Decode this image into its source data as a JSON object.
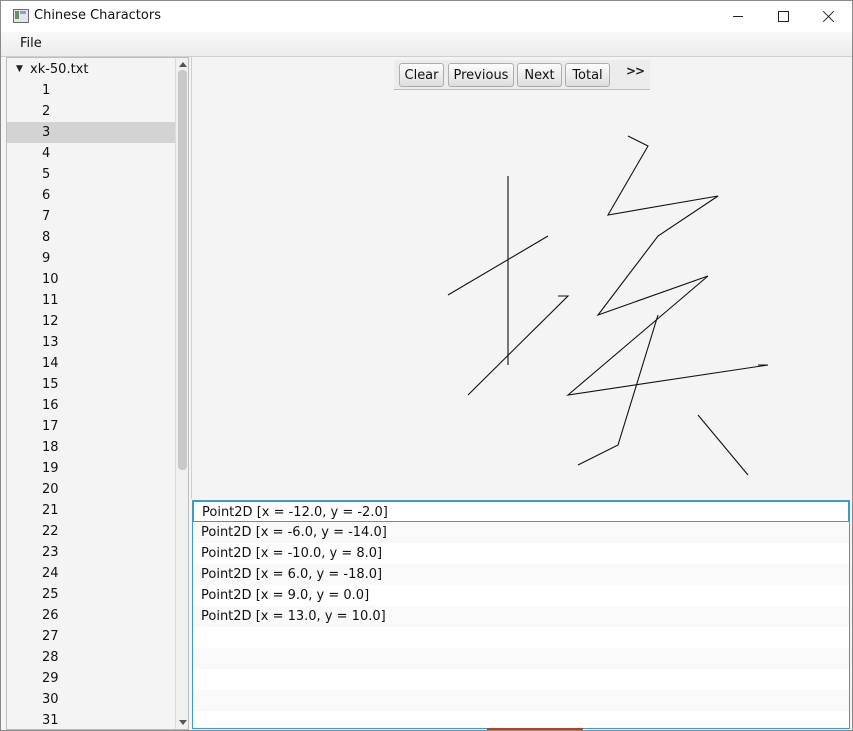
{
  "window": {
    "title": "Chinese Charactors",
    "icon": "app-icon",
    "controls": [
      "minimize-icon",
      "maximize-icon",
      "close-icon"
    ]
  },
  "menu": {
    "file_label": "File"
  },
  "tree": {
    "root_label": "xk-50.txt",
    "expand_icon": "triangle-down-icon",
    "items": [
      "1",
      "2",
      "3",
      "4",
      "5",
      "6",
      "7",
      "8",
      "9",
      "10",
      "11",
      "12",
      "13",
      "14",
      "15",
      "16",
      "17",
      "18",
      "19",
      "20",
      "21",
      "22",
      "23",
      "24",
      "25",
      "26",
      "27",
      "28",
      "29",
      "30",
      "31"
    ],
    "selected": "3"
  },
  "toolbar": {
    "clear_label": "Clear",
    "previous_label": "Previous",
    "next_label": "Next",
    "total_label": "Total",
    "more_label": ">>"
  },
  "points": [
    "Point2D [x = -12.0, y = -2.0]",
    "Point2D [x = -6.0, y = -14.0]",
    "Point2D [x = -10.0, y = 8.0]",
    "Point2D [x = 6.0, y = -18.0]",
    "Point2D [x = 9.0, y = 0.0]",
    "Point2D [x = 13.0, y = 10.0]"
  ],
  "colors": {
    "list_focus": "#3a9cc8",
    "selection": "#d3d3d3",
    "stroke": "#111111"
  }
}
